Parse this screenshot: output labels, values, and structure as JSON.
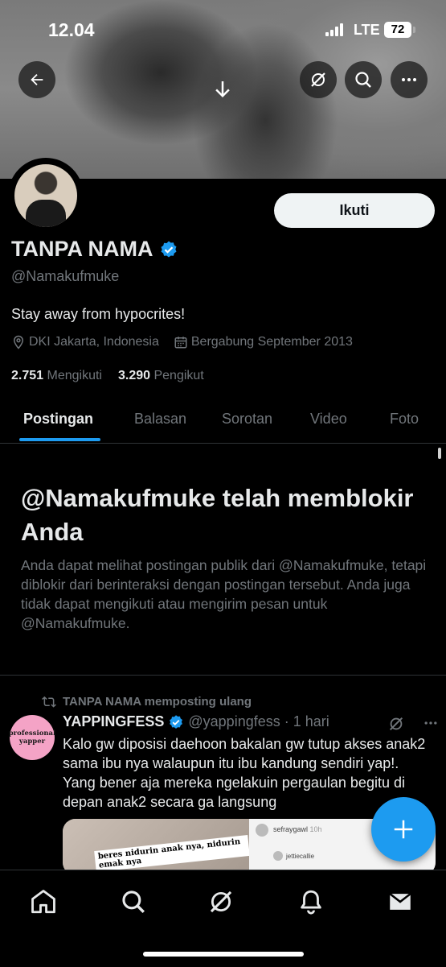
{
  "status_bar": {
    "time": "12.04",
    "network": "LTE",
    "battery": "72"
  },
  "profile": {
    "name": "TANPA NAMA",
    "handle": "@Namakufmuke",
    "bio": "Stay away from hypocrites!",
    "location": "DKI Jakarta, Indonesia",
    "joined": "Bergabung September 2013",
    "following_count": "2.751",
    "following_label": "Mengikuti",
    "followers_count": "3.290",
    "followers_label": "Pengikut",
    "follow_button": "Ikuti",
    "verified": true
  },
  "tabs": [
    {
      "label": "Postingan",
      "active": true
    },
    {
      "label": "Balasan",
      "active": false
    },
    {
      "label": "Sorotan",
      "active": false
    },
    {
      "label": "Video",
      "active": false
    },
    {
      "label": "Foto",
      "active": false
    }
  ],
  "blocked": {
    "title": "@Namakufmuke telah memblokir Anda",
    "body": "Anda dapat melihat postingan publik dari @Namakufmuke, tetapi diblokir dari berinteraksi dengan postingan tersebut. Anda juga tidak dapat mengikuti atau mengirim pesan untuk @Namakufmuke."
  },
  "post": {
    "repost_label": "TANPA NAMA memposting ulang",
    "author_name": "YAPPINGFESS",
    "author_handle": "@yappingfess",
    "separator": "·",
    "time": "1 hari",
    "avatar_text": "professional yapper",
    "text": "Kalo gw diposisi daehoon bakalan gw tutup akses anak2 sama ibu nya walaupun itu ibu kandung sendiri yap!. Yang bener aja mereka ngelakuin pergaulan begitu di depan anak2 secara ga langsung",
    "media_caption": "beres nidurin anak nya, nidurin emak nya",
    "media_user1": "sefraygawl",
    "media_user1_time": "10h",
    "media_user2": "jettiecallie"
  },
  "colors": {
    "accent": "#1d9bf0",
    "background": "#000000",
    "muted": "#71767b",
    "text": "#e7e9ea"
  },
  "nav": [
    "home-icon",
    "search-icon",
    "grok-icon",
    "notifications-icon",
    "messages-icon"
  ]
}
